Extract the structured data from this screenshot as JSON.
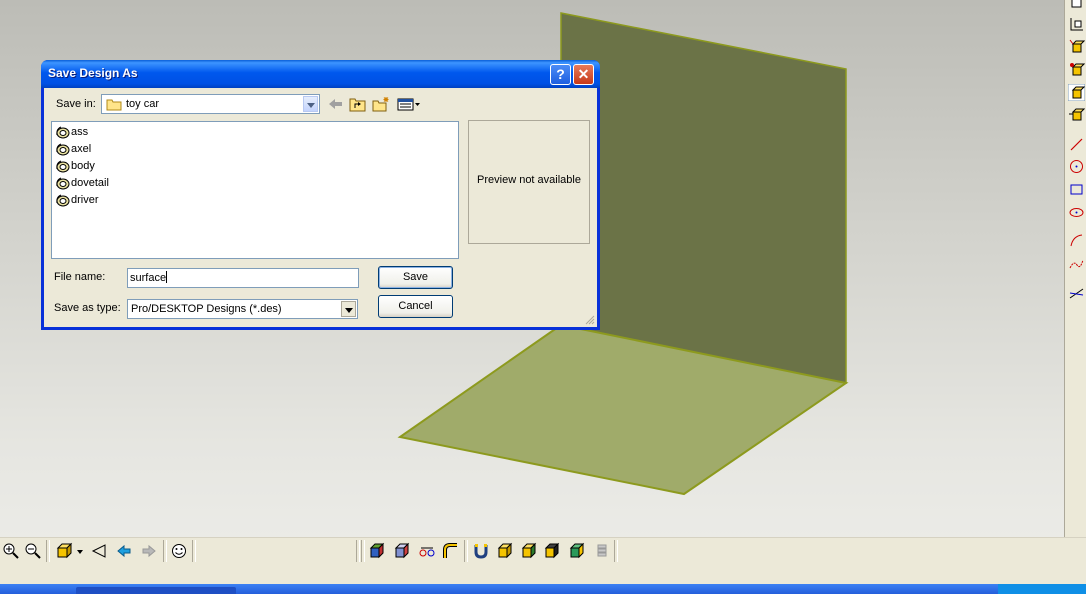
{
  "dialog": {
    "title": "Save Design As",
    "help_glyph": "?",
    "close_glyph": "✕",
    "save_in_label": "Save in:",
    "save_in_value": "toy car",
    "files": [
      {
        "name": "ass",
        "icon": "design-file-icon"
      },
      {
        "name": "axel",
        "icon": "design-file-icon"
      },
      {
        "name": "body",
        "icon": "design-file-icon"
      },
      {
        "name": "dovetail",
        "icon": "design-file-icon"
      },
      {
        "name": "driver",
        "icon": "design-file-icon"
      }
    ],
    "preview_text": "Preview not available",
    "file_name_label": "File name:",
    "file_name_value": "surface",
    "save_as_type_label": "Save as type:",
    "save_as_type_value": "Pro/DESKTOP Designs (*.des)",
    "save_label": "Save",
    "cancel_label": "Cancel",
    "nav_icons": [
      "back-arrow-icon",
      "up-folder-icon",
      "new-folder-icon",
      "view-menu-icon"
    ]
  },
  "colors": {
    "vertical_plane": "#6b7347",
    "horizontal_plane": "#a0ab6a",
    "plane_edge": "#8d9a1e",
    "dialog_frame": "#0831d9",
    "dialog_face": "#ece9d8"
  },
  "right_toolbar_icons": [
    "workplane-icon",
    "sketch-icon",
    "extrude-icon",
    "revolve-icon",
    "sweep-icon",
    "loft-icon",
    "line-icon",
    "circle-icon",
    "rectangle-icon",
    "ellipse-icon",
    "arc-icon",
    "spline-icon",
    "constraint-icon"
  ],
  "bottom_toolbar_icons": [
    "zoom-in-icon",
    "zoom-out-icon",
    "view-cube-icon",
    "dropdown-arrow-icon",
    "perspective-icon",
    "view-previous-icon",
    "view-next-icon",
    "smiley-icon",
    "render-shaded-icon",
    "render-hidden-icon",
    "render-wire-icon",
    "render-bend-icon",
    "magnet-icon",
    "box-icon",
    "box-select-icon",
    "box-edge-icon",
    "box-color-icon",
    "stack-icon"
  ]
}
